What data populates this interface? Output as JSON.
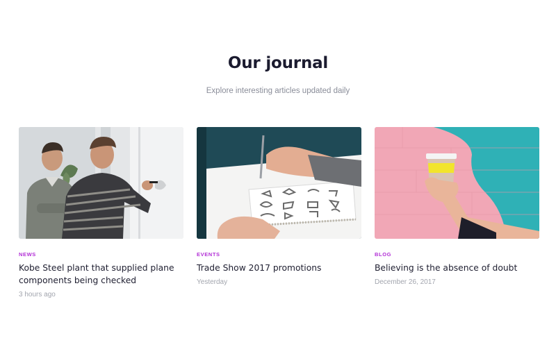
{
  "section": {
    "title": "Our journal",
    "subtitle": "Explore interesting articles updated daily"
  },
  "articles": [
    {
      "category": "NEWS",
      "category_color": "#b22fd6",
      "title": "Kobe Steel plant that supplied plane components being checked",
      "time": "3 hours ago",
      "image": "two-men-whiteboard-photo"
    },
    {
      "category": "EVENTS",
      "category_color": "#b22fd6",
      "title": "Trade Show 2017 promotions",
      "time": "Yesterday",
      "image": "logo-sketch-notebook-photo"
    },
    {
      "category": "BLOG",
      "category_color": "#b22fd6",
      "title": "Believing is the absence of doubt",
      "time": "December 26, 2017",
      "image": "coffee-cup-pink-wall-photo"
    }
  ]
}
